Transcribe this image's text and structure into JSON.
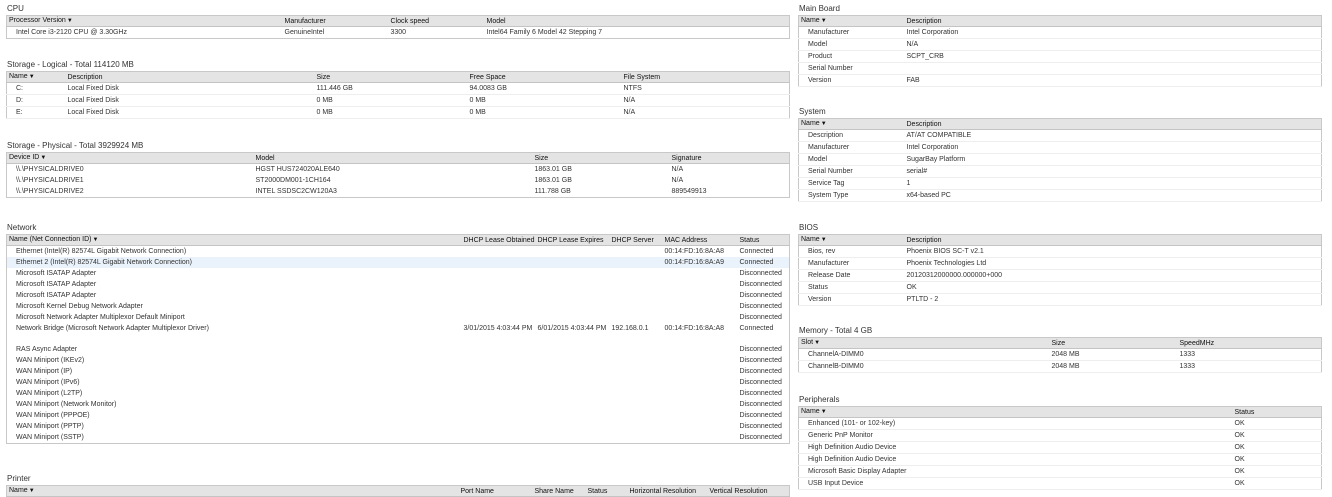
{
  "cpu": {
    "title": "CPU",
    "cols": [
      "Processor Version",
      "Manufacturer",
      "Clock speed",
      "Model"
    ],
    "rows": [
      [
        "Intel Core i3-2120 CPU @ 3.30GHz",
        "GenuineIntel",
        "3300",
        "Intel64 Family 6 Model 42 Stepping 7"
      ]
    ]
  },
  "storage_logical": {
    "title": "Storage - Logical - Total 114120 MB",
    "cols": [
      "Name",
      "Description",
      "Size",
      "Free Space",
      "File System"
    ],
    "rows": [
      [
        "C:",
        "Local Fixed Disk",
        "111.446 GB",
        "94.0083 GB",
        "NTFS"
      ],
      [
        "D:",
        "Local Fixed Disk",
        "0 MB",
        "0 MB",
        "N/A"
      ],
      [
        "E:",
        "Local Fixed Disk",
        "0 MB",
        "0 MB",
        "N/A"
      ]
    ]
  },
  "storage_physical": {
    "title": "Storage - Physical - Total 3929924 MB",
    "cols": [
      "Device ID",
      "Model",
      "Size",
      "Signature"
    ],
    "rows": [
      [
        "\\\\.\\PHYSICALDRIVE0",
        "HGST HUS724020ALE640",
        "1863.01 GB",
        "N/A"
      ],
      [
        "\\\\.\\PHYSICALDRIVE1",
        "ST2000DM001-1CH164",
        "1863.01 GB",
        "N/A"
      ],
      [
        "\\\\.\\PHYSICALDRIVE2",
        "INTEL SSDSC2CW120A3",
        "111.788 GB",
        "889549913"
      ]
    ]
  },
  "network": {
    "title": "Network",
    "cols": [
      "Name (Net Connection ID)",
      "DHCP Lease Obtained",
      "DHCP Lease Expires",
      "DHCP Server",
      "MAC Address",
      "Status"
    ],
    "rows": [
      [
        "Ethernet (Intel(R) 82574L Gigabit Network Connection)",
        "",
        "",
        "",
        "00:14:FD:16:8A:A8",
        "Connected"
      ],
      [
        "Ethernet 2 (Intel(R) 82574L Gigabit Network Connection)",
        "",
        "",
        "",
        "00:14:FD:16:8A:A9",
        "Connected"
      ],
      [
        "Microsoft ISATAP Adapter",
        "",
        "",
        "",
        "",
        "Disconnected"
      ],
      [
        "Microsoft ISATAP Adapter",
        "",
        "",
        "",
        "",
        "Disconnected"
      ],
      [
        "Microsoft ISATAP Adapter",
        "",
        "",
        "",
        "",
        "Disconnected"
      ],
      [
        "Microsoft Kernel Debug Network Adapter",
        "",
        "",
        "",
        "",
        "Disconnected"
      ],
      [
        "Microsoft Network Adapter Multiplexor Default Miniport",
        "",
        "",
        "",
        "",
        "Disconnected"
      ],
      [
        "Network Bridge (Microsoft Network Adapter Multiplexor Driver)",
        "3/01/2015 4:03:44 PM",
        "6/01/2015 4:03:44 PM",
        "192.168.0.1",
        "00:14:FD:16:8A:A8",
        "Connected"
      ],
      [
        "RAS Async Adapter",
        "",
        "",
        "",
        "",
        "Disconnected"
      ],
      [
        "WAN Miniport (IKEv2)",
        "",
        "",
        "",
        "",
        "Disconnected"
      ],
      [
        "WAN Miniport (IP)",
        "",
        "",
        "",
        "",
        "Disconnected"
      ],
      [
        "WAN Miniport (IPv6)",
        "",
        "",
        "",
        "",
        "Disconnected"
      ],
      [
        "WAN Miniport (L2TP)",
        "",
        "",
        "",
        "",
        "Disconnected"
      ],
      [
        "WAN Miniport (Network Monitor)",
        "",
        "",
        "",
        "",
        "Disconnected"
      ],
      [
        "WAN Miniport (PPPOE)",
        "",
        "",
        "",
        "",
        "Disconnected"
      ],
      [
        "WAN Miniport (PPTP)",
        "",
        "",
        "",
        "",
        "Disconnected"
      ],
      [
        "WAN Miniport (SSTP)",
        "",
        "",
        "",
        "",
        "Disconnected"
      ]
    ]
  },
  "printer": {
    "title": "Printer",
    "cols": [
      "Name",
      "Port Name",
      "Share Name",
      "Status",
      "Horizontal Resolution",
      "Vertical Resolution"
    ]
  },
  "mainboard": {
    "title": "Main Board",
    "cols": [
      "Name",
      "Description"
    ],
    "rows": [
      [
        "Manufacturer",
        "Intel Corporation"
      ],
      [
        "Model",
        "N/A"
      ],
      [
        "Product",
        "SCPT_CRB"
      ],
      [
        "Serial Number",
        ""
      ],
      [
        "Version",
        "FAB"
      ]
    ]
  },
  "system": {
    "title": "System",
    "cols": [
      "Name",
      "Description"
    ],
    "rows": [
      [
        "Description",
        "AT/AT COMPATIBLE"
      ],
      [
        "Manufacturer",
        "Intel Corporation"
      ],
      [
        "Model",
        "SugarBay Platform"
      ],
      [
        "Serial Number",
        "serial#"
      ],
      [
        "Service Tag",
        "1"
      ],
      [
        "System Type",
        "x64-based PC"
      ]
    ]
  },
  "bios": {
    "title": "BIOS",
    "cols": [
      "Name",
      "Description"
    ],
    "rows": [
      [
        "Bios, rev",
        "Phoenix BIOS SC-T v2.1"
      ],
      [
        "Manufacturer",
        "Phoenix Technologies Ltd"
      ],
      [
        "Release Date",
        "20120312000000.000000+000"
      ],
      [
        "Status",
        "OK"
      ],
      [
        "Version",
        "PTLTD - 2"
      ]
    ]
  },
  "memory": {
    "title": "Memory - Total 4 GB",
    "cols": [
      "Slot",
      "Size",
      "SpeedMHz"
    ],
    "rows": [
      [
        "ChannelA-DIMM0",
        "2048 MB",
        "1333"
      ],
      [
        "ChannelB-DIMM0",
        "2048 MB",
        "1333"
      ]
    ]
  },
  "peripherals": {
    "title": "Peripherals",
    "cols": [
      "Name",
      "Status"
    ],
    "rows": [
      [
        "Enhanced (101- or 102-key)",
        "OK"
      ],
      [
        "Generic PnP Monitor",
        "OK"
      ],
      [
        "High Definition Audio Device",
        "OK"
      ],
      [
        "High Definition Audio Device",
        "OK"
      ],
      [
        "Microsoft Basic Display Adapter",
        "OK"
      ],
      [
        "USB Input Device",
        "OK"
      ]
    ]
  },
  "sort_icon": "triangle-down"
}
